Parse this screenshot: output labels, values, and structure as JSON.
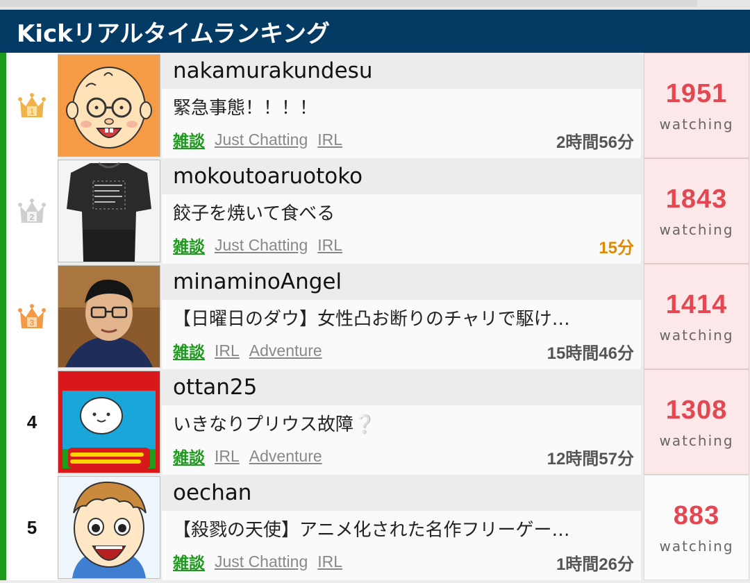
{
  "header": {
    "title": "Kickリアルタイムランキング"
  },
  "colors": {
    "accent": "#1c9a1c",
    "header_bg": "#033b64",
    "viewers": "#e24752",
    "new_duration": "#e08a00"
  },
  "rows": [
    {
      "rank": "1",
      "rank_icon": "gold-crown-icon",
      "name": "nakamurakundesu",
      "title": "緊急事態！！！！",
      "tags": [
        "雑談",
        "Just Chatting",
        "IRL"
      ],
      "duration": "2時間56分",
      "viewers": "1951",
      "watching": "watching"
    },
    {
      "rank": "2",
      "rank_icon": "silver-crown-icon",
      "name": "mokoutoaruotoko",
      "title": "餃子を焼いて食べる",
      "tags": [
        "雑談",
        "Just Chatting",
        "IRL"
      ],
      "duration": "15分",
      "viewers": "1843",
      "watching": "watching"
    },
    {
      "rank": "3",
      "rank_icon": "bronze-crown-icon",
      "name": "minaminoAngel",
      "title": "【日曜日のダウ】女性凸お断りのチャリで駆け…",
      "tags": [
        "雑談",
        "IRL",
        "Adventure"
      ],
      "duration": "15時間46分",
      "viewers": "1414",
      "watching": "watching"
    },
    {
      "rank": "4",
      "rank_icon": "",
      "name": "ottan25",
      "title": "いきなりプリウス故障❔",
      "tags": [
        "雑談",
        "IRL",
        "Adventure"
      ],
      "duration": "12時間57分",
      "viewers": "1308",
      "watching": "watching"
    },
    {
      "rank": "5",
      "rank_icon": "",
      "name": "oechan",
      "title": "【殺戮の天使】アニメ化された名作フリーゲー…",
      "tags": [
        "雑談",
        "Just Chatting",
        "IRL"
      ],
      "duration": "1時間26分",
      "viewers": "883",
      "watching": "watching"
    }
  ]
}
